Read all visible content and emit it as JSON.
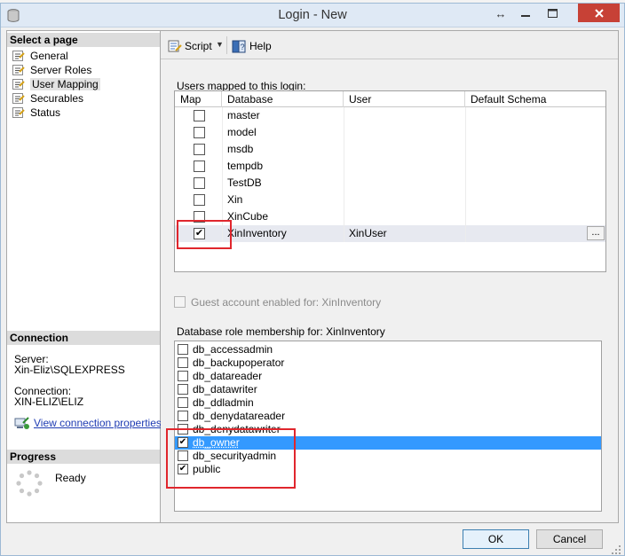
{
  "window": {
    "title": "Login - New",
    "controls": {
      "move": "↔",
      "minimize": "▬",
      "maximize": "☐",
      "close": "✕"
    }
  },
  "select_page": {
    "heading": "Select a page",
    "items": [
      {
        "label": "General",
        "icon": "page-icon"
      },
      {
        "label": "Server Roles",
        "icon": "page-icon"
      },
      {
        "label": "User Mapping",
        "icon": "page-icon",
        "selected": true
      },
      {
        "label": "Securables",
        "icon": "page-icon"
      },
      {
        "label": "Status",
        "icon": "page-icon"
      }
    ]
  },
  "connection": {
    "heading": "Connection",
    "server_label": "Server:",
    "server_value": "Xin-Eliz\\SQLEXPRESS",
    "connection_label": "Connection:",
    "connection_value": "XIN-ELIZ\\ELIZ",
    "view_link": "View connection properties"
  },
  "progress": {
    "heading": "Progress",
    "status": "Ready"
  },
  "toolbar": {
    "script_label": "Script",
    "help_label": "Help"
  },
  "users_mapped": {
    "label": "Users mapped to this login:",
    "columns": [
      "Map",
      "Database",
      "User",
      "Default Schema"
    ],
    "rows": [
      {
        "map": false,
        "database": "master",
        "user": "",
        "schema": ""
      },
      {
        "map": false,
        "database": "model",
        "user": "",
        "schema": ""
      },
      {
        "map": false,
        "database": "msdb",
        "user": "",
        "schema": ""
      },
      {
        "map": false,
        "database": "tempdb",
        "user": "",
        "schema": ""
      },
      {
        "map": false,
        "database": "TestDB",
        "user": "",
        "schema": ""
      },
      {
        "map": false,
        "database": "Xin",
        "user": "",
        "schema": ""
      },
      {
        "map": false,
        "database": "XinCube",
        "user": "",
        "schema": ""
      },
      {
        "map": true,
        "database": "XinInventory",
        "user": "XinUser",
        "schema": "",
        "selected": true
      }
    ],
    "ellipsis": "..."
  },
  "guest": {
    "label": "Guest account enabled for: XinInventory",
    "checked": false,
    "enabled": false
  },
  "role_membership": {
    "label": "Database role membership for: XinInventory",
    "roles": [
      {
        "name": "db_accessadmin",
        "checked": false
      },
      {
        "name": "db_backupoperator",
        "checked": false
      },
      {
        "name": "db_datareader",
        "checked": false
      },
      {
        "name": "db_datawriter",
        "checked": false
      },
      {
        "name": "db_ddladmin",
        "checked": false
      },
      {
        "name": "db_denydatareader",
        "checked": false
      },
      {
        "name": "db_denydatawriter",
        "checked": false
      },
      {
        "name": "db_owner",
        "checked": true,
        "selected": true
      },
      {
        "name": "db_securityadmin",
        "checked": false
      },
      {
        "name": "public",
        "checked": true
      }
    ]
  },
  "buttons": {
    "ok": "OK",
    "cancel": "Cancel"
  },
  "colors": {
    "selection": "#3399ff",
    "highlight_box": "#e0262d",
    "link": "#1f3cb3",
    "close": "#c74136"
  },
  "checkmark": "✔"
}
